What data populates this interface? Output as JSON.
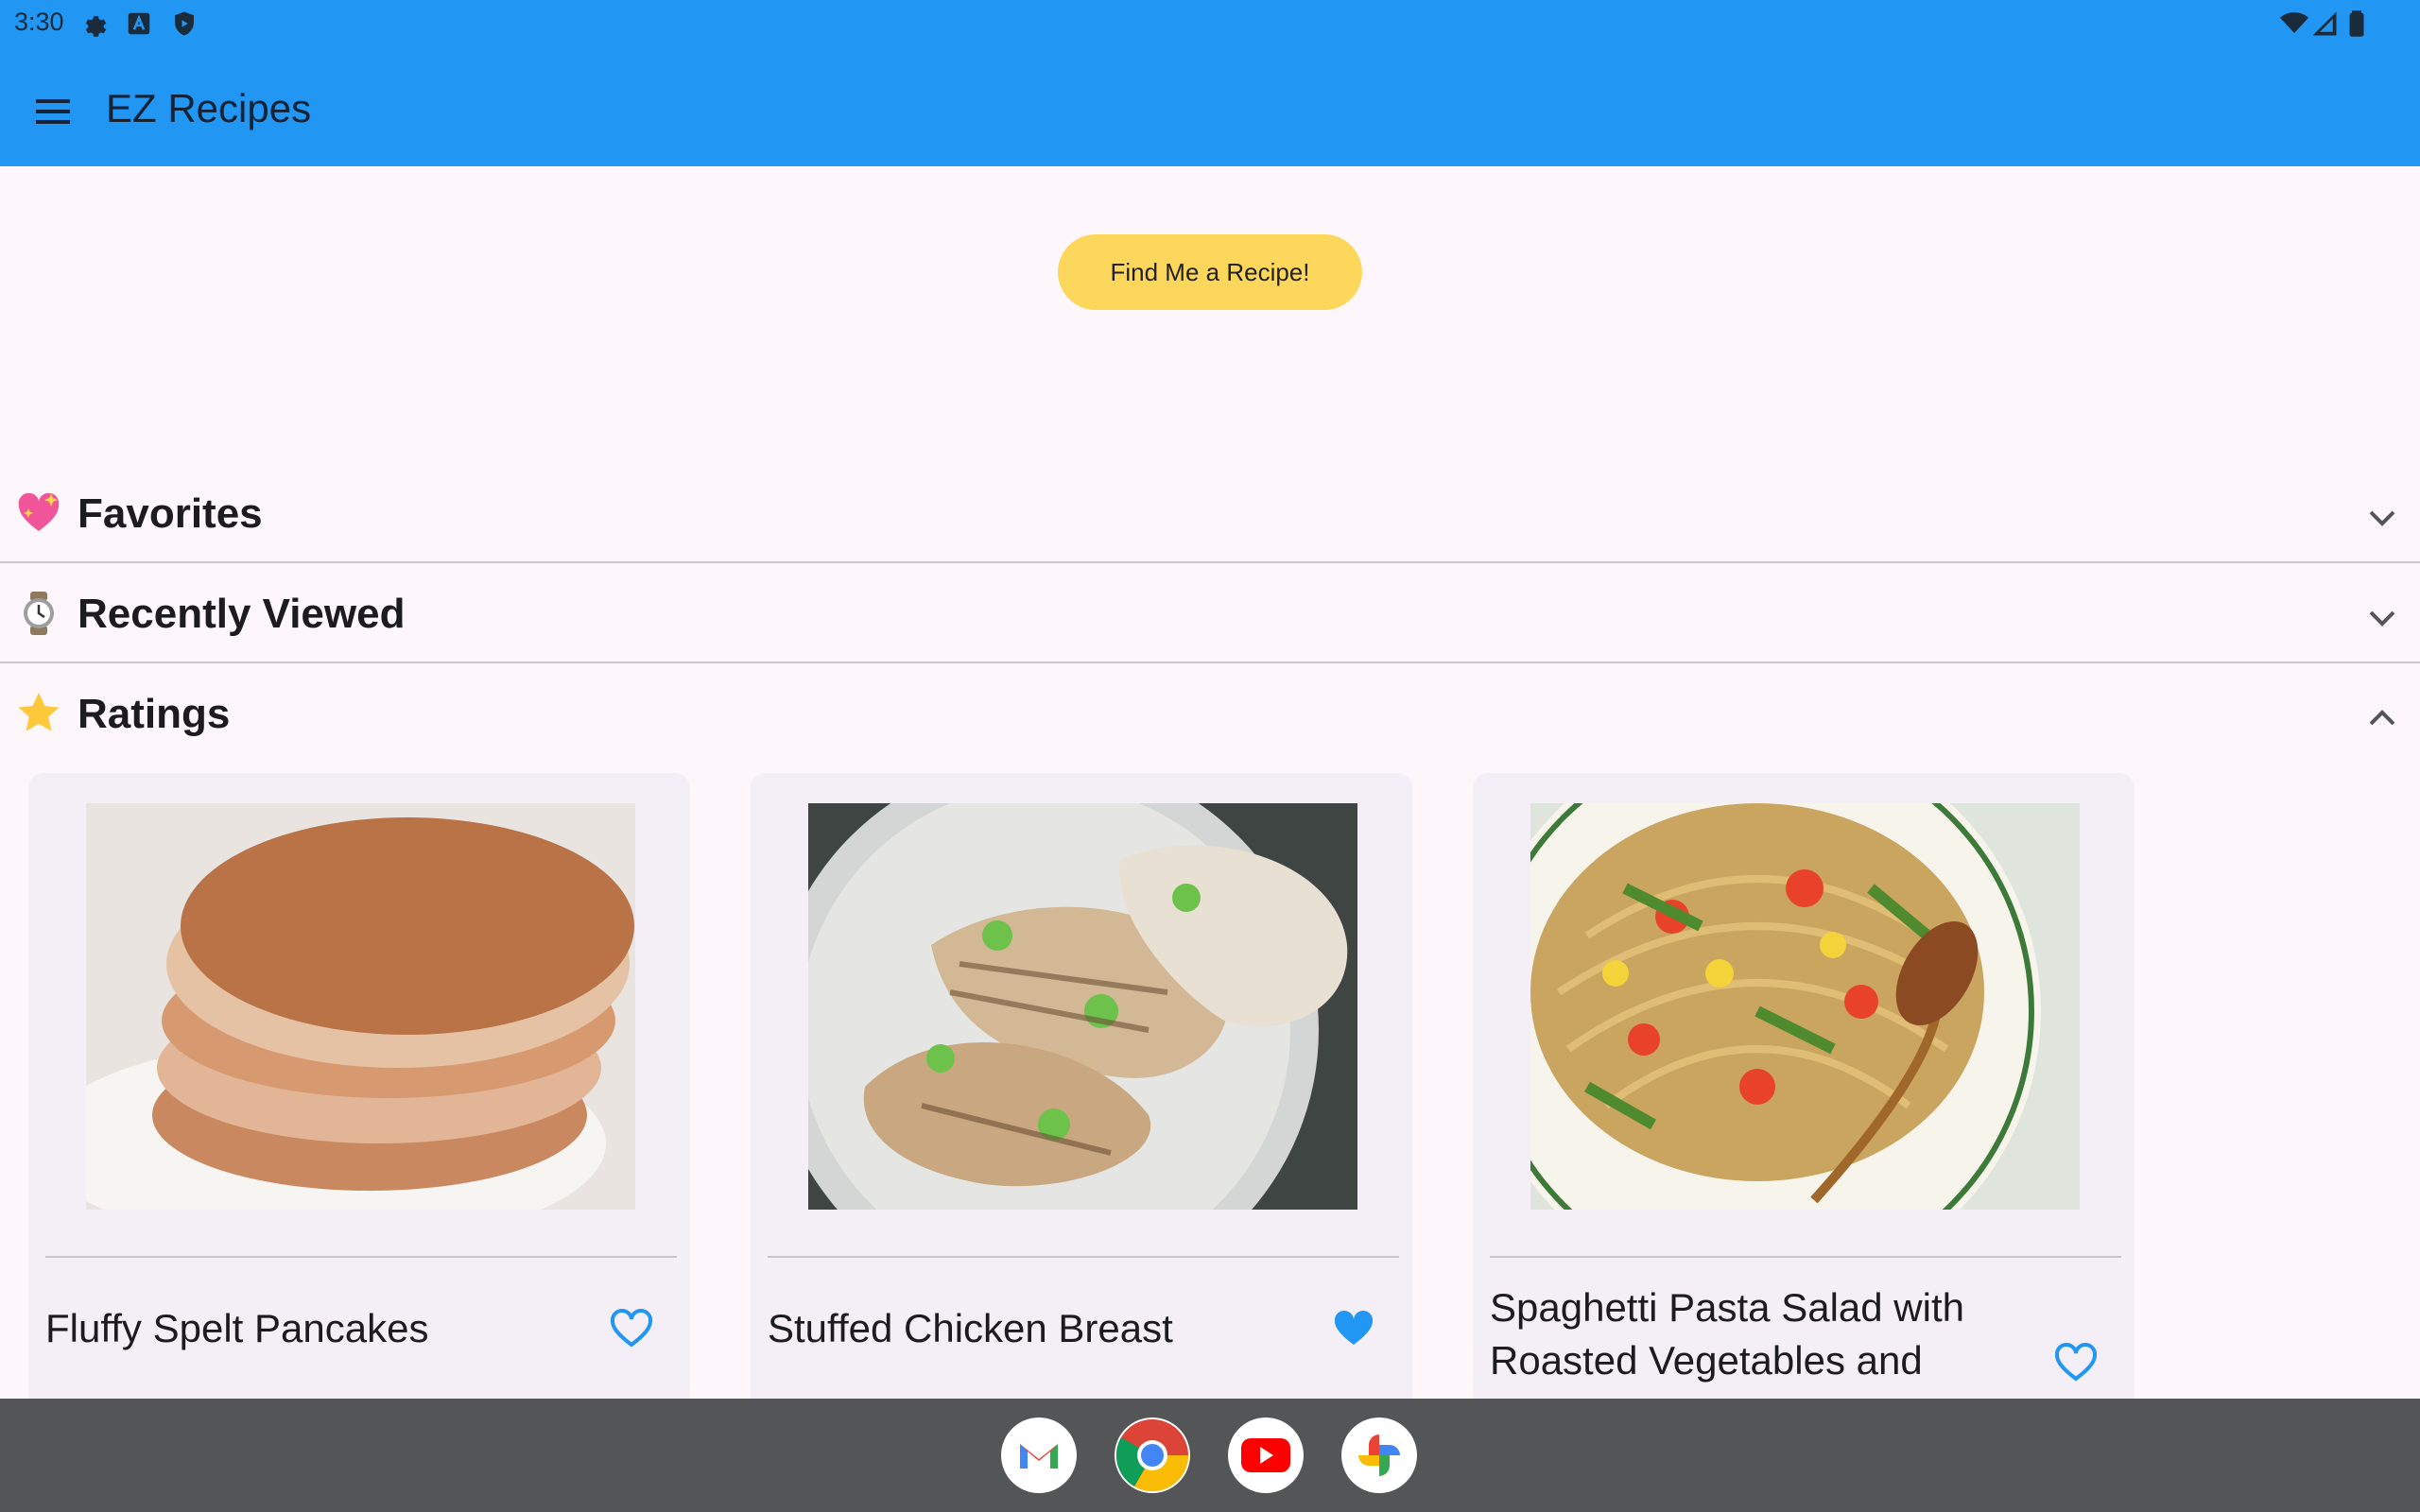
{
  "status_bar": {
    "time": "3:30",
    "left_icons": [
      "gear-icon",
      "font-a-icon",
      "shield-icon"
    ],
    "right_icons": [
      "wifi-icon",
      "cell-signal-icon",
      "battery-icon"
    ]
  },
  "app_bar": {
    "title": "EZ Recipes",
    "background": "#2196f3",
    "menu_icon": "hamburger-menu-icon"
  },
  "find_button": {
    "label": "Find Me a Recipe!",
    "color": "#fdd75b"
  },
  "sections": [
    {
      "emoji": "sparkling-heart-icon",
      "title": "Favorites",
      "expanded": false
    },
    {
      "emoji": "watch-icon",
      "title": "Recently Viewed",
      "expanded": false
    },
    {
      "emoji": "star-icon",
      "title": "Ratings",
      "expanded": true
    }
  ],
  "ratings_cards": [
    {
      "name": "Fluffy Spelt Pancakes",
      "favorited": false,
      "image": "pancakes-photo"
    },
    {
      "name": "Stuffed Chicken Breast",
      "favorited": true,
      "image": "chicken-photo"
    },
    {
      "name": "Spaghetti Pasta Salad with Roasted Vegetables and",
      "favorited": false,
      "image": "pasta-salad-photo"
    }
  ],
  "dock_apps": [
    "gmail-icon",
    "chrome-icon",
    "youtube-icon",
    "photos-icon"
  ],
  "colors": {
    "accent_heart": "#2196f3",
    "page_background": "#fdf7fc",
    "card_background": "#f4eff6",
    "nav_background": "#545556"
  }
}
